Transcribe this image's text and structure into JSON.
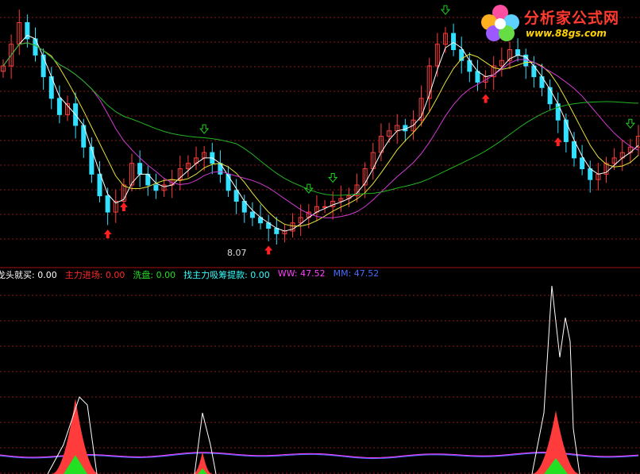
{
  "logo": {
    "cn": "分析家公式网",
    "url": "www.88gs.com"
  },
  "low_price_label": "8.07",
  "legend": {
    "items": [
      {
        "name": "龙头就买",
        "value": "0.00",
        "color": "#ffffff"
      },
      {
        "name": "主力进场",
        "value": "0.00",
        "color": "#ff2a2a"
      },
      {
        "name": "洗盘",
        "value": "0.00",
        "color": "#22e022"
      },
      {
        "name": "找主力吸筹提款",
        "value": "0.00",
        "color": "#33ffff"
      },
      {
        "name": "WW",
        "value": "47.52",
        "color": "#ff40ff"
      },
      {
        "name": "MM",
        "value": "47.52",
        "color": "#4a6bff"
      }
    ],
    "name_sep": ":"
  },
  "colors": {
    "up": "#ff3b3b",
    "down": "#33e0ff",
    "ma_white": "#ffffff",
    "ma_yellow": "#e8e23a",
    "ma_magenta": "#d03ad0",
    "ma_green": "#22b522",
    "grid": "#8a1a1a",
    "arrow_up": "#ff2020",
    "arrow_down": "#22d022"
  },
  "chart_data": {
    "type": "candlestick",
    "prices": [
      11.2,
      11.6,
      12.0,
      11.7,
      11.4,
      11.0,
      10.6,
      10.3,
      10.5,
      10.1,
      9.7,
      9.2,
      8.8,
      8.5,
      8.7,
      9.0,
      9.4,
      9.2,
      9.0,
      8.9,
      9.0,
      9.1,
      9.3,
      9.4,
      9.5,
      9.6,
      9.4,
      9.2,
      8.9,
      8.7,
      8.5,
      8.4,
      8.3,
      8.2,
      8.1,
      8.15,
      8.3,
      8.4,
      8.5,
      8.6,
      8.6,
      8.7,
      8.75,
      8.8,
      9.0,
      9.3,
      9.6,
      9.9,
      10.0,
      10.1,
      10.0,
      10.2,
      10.6,
      11.2,
      11.6,
      11.8,
      11.5,
      11.3,
      11.1,
      10.9,
      11.0,
      11.2,
      11.3,
      11.5,
      11.4,
      11.2,
      11.0,
      10.8,
      10.5,
      10.2,
      9.8,
      9.5,
      9.3,
      9.1,
      9.2,
      9.4,
      9.5,
      9.6,
      9.7,
      9.9
    ],
    "low_label": "8.07"
  },
  "arrows": {
    "up": [
      13,
      15,
      33,
      60,
      69
    ],
    "down": [
      25,
      38,
      41,
      55,
      63,
      78
    ]
  }
}
